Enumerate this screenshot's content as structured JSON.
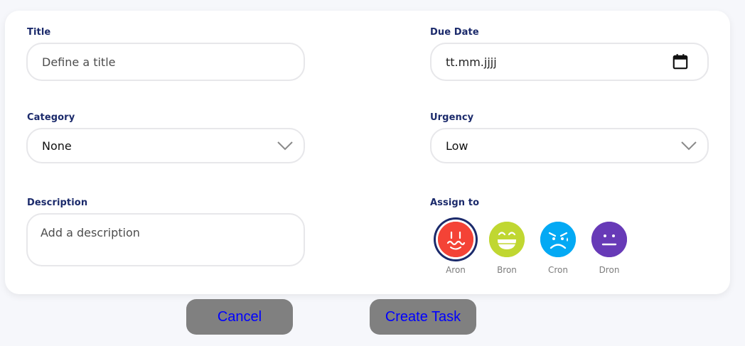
{
  "form": {
    "title": {
      "label": "Title",
      "placeholder": "Define a title"
    },
    "due_date": {
      "label": "Due Date",
      "placeholder": "tt.mm.jjjj",
      "icon": "calendar-icon"
    },
    "category": {
      "label": "Category",
      "value": "None",
      "icon": "chevron-down-icon"
    },
    "urgency": {
      "label": "Urgency",
      "value": "Low",
      "icon": "chevron-down-icon"
    },
    "description": {
      "label": "Description",
      "placeholder": "Add a description"
    },
    "assign": {
      "label": "Assign to",
      "users": [
        {
          "name": "Aron",
          "color": "#f44336",
          "selected": true,
          "icon": "wavy-smile-face-icon"
        },
        {
          "name": "Bron",
          "color": "#c0d731",
          "selected": false,
          "icon": "grin-face-icon"
        },
        {
          "name": "Cron",
          "color": "#03a9f4",
          "selected": false,
          "icon": "angry-face-icon"
        },
        {
          "name": "Dron",
          "color": "#673ab7",
          "selected": false,
          "icon": "neutral-face-icon"
        }
      ]
    }
  },
  "actions": {
    "cancel_label": "Cancel",
    "create_label": "Create Task"
  },
  "colors": {
    "label_text": "#1b2a6b",
    "button_bg": "#808080",
    "button_text": "#0000ff",
    "field_border": "#e7e7ea"
  }
}
